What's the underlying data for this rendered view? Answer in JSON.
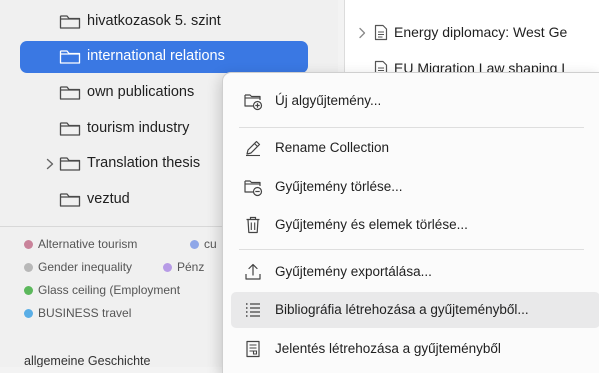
{
  "collections": [
    {
      "label": "hivatkozasok 5. szint",
      "selected": false,
      "has_children": false
    },
    {
      "label": "international relations",
      "selected": true,
      "has_children": false
    },
    {
      "label": "own publications",
      "selected": false,
      "has_children": false
    },
    {
      "label": "tourism industry",
      "selected": false,
      "has_children": false
    },
    {
      "label": "Translation thesis",
      "selected": false,
      "has_children": true
    },
    {
      "label": "veztud",
      "selected": false,
      "has_children": false
    }
  ],
  "tags": [
    {
      "label": "Alternative tourism",
      "color": "#c9839a"
    },
    {
      "label": "cu",
      "color": "#8fa7e8"
    },
    {
      "label": "Gender inequality",
      "color": "#b8b8b8"
    },
    {
      "label": "Pénz",
      "color": "#b79be6"
    },
    {
      "label": "Glass ceiling (Employment",
      "color": "#5cb85c"
    },
    {
      "label": "BUSINESS travel",
      "color": "#5aaee6"
    }
  ],
  "bottom_label": "allgemeine Geschichte",
  "items": [
    {
      "title": "Energy diplomacy: West Ge",
      "has_children": true
    },
    {
      "title": "EU Migration Law shaping I",
      "has_children": false
    }
  ],
  "item_fragments": [
    "a",
    "a",
    "a",
    "a"
  ],
  "context_menu": [
    {
      "label": "Új algyűjtemény...",
      "icon": "new-subcollection-icon"
    },
    {
      "label": "Rename Collection",
      "icon": "pencil-icon"
    },
    {
      "label": "Gyűjtemény törlése...",
      "icon": "delete-collection-icon"
    },
    {
      "label": "Gyűjtemény és elemek törlése...",
      "icon": "trash-icon"
    },
    {
      "label": "Gyűjtemény exportálása...",
      "icon": "export-icon"
    },
    {
      "label": "Bibliográfia létrehozása a gyűjteményből...",
      "icon": "bibliography-icon",
      "hovered": true
    },
    {
      "label": "Jelentés létrehozása a gyűjteményből",
      "icon": "report-icon"
    }
  ],
  "colors": {
    "selection": "#3a78e3",
    "menu_hover": "#e9e9ea"
  }
}
